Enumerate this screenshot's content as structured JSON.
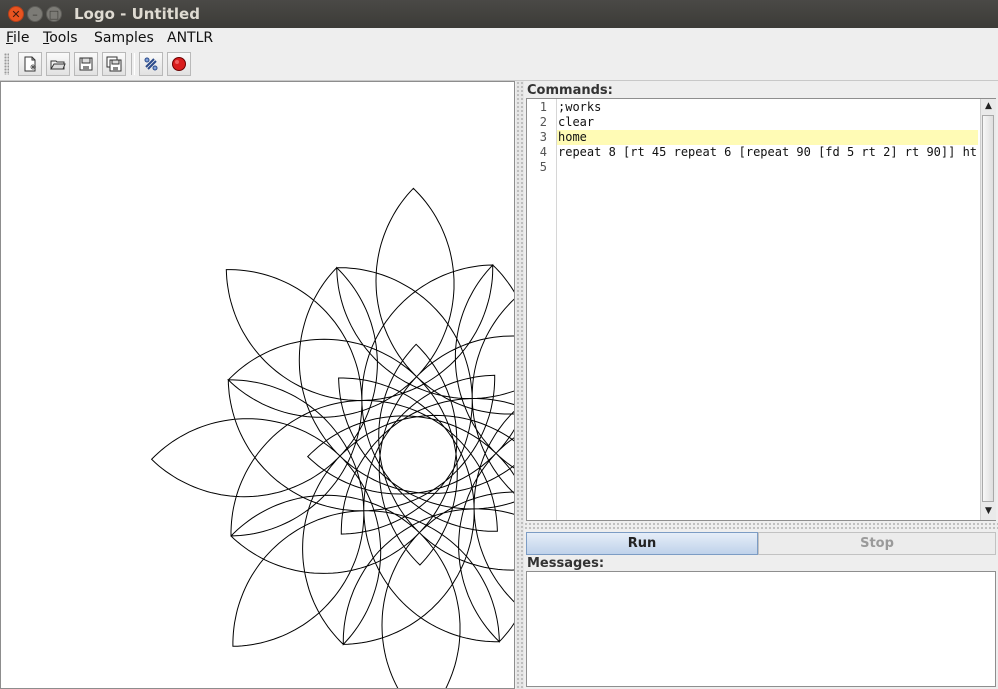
{
  "window": {
    "title": "Logo - Untitled"
  },
  "menu": [
    {
      "label": "File",
      "mnemonic": "F",
      "rest": "ile"
    },
    {
      "label": "Tools",
      "mnemonic": "T",
      "rest": "ools"
    },
    {
      "label": "Samples",
      "mnemonic": "",
      "rest": "Samples"
    },
    {
      "label": "ANTLR",
      "mnemonic": "",
      "rest": "ANTLR"
    }
  ],
  "toolbar": {
    "buttons": [
      {
        "icon": "new-file-icon"
      },
      {
        "icon": "open-folder-icon"
      },
      {
        "icon": "save-icon"
      },
      {
        "icon": "save-as-icon"
      },
      {
        "icon": "run-script-icon"
      },
      {
        "icon": "stop-record-icon"
      }
    ]
  },
  "commands": {
    "label": "Commands:",
    "lines": [
      {
        "num": "1",
        "text": ";works"
      },
      {
        "num": "2",
        "text": "clear"
      },
      {
        "num": "3",
        "text": "home"
      },
      {
        "num": "4",
        "text": "repeat 8 [rt 45 repeat 6 [repeat 90 [fd 5 rt 2] rt 90]] ht"
      },
      {
        "num": "5",
        "text": ""
      }
    ],
    "current_line": 3
  },
  "buttons": {
    "run": "Run",
    "stop": "Stop"
  },
  "messages": {
    "label": "Messages:",
    "text": ""
  },
  "colors": {
    "highlight": "#fffbb5",
    "close": "#e95420",
    "stroke": "#000000"
  }
}
